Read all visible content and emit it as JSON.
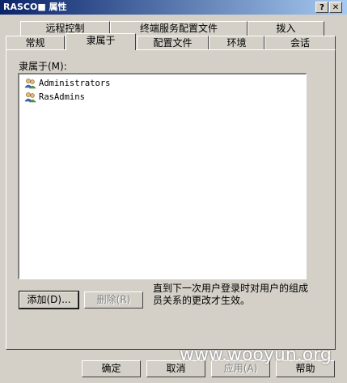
{
  "window": {
    "title": "RASCO■ 属性"
  },
  "titlebar_buttons": {
    "help": "?",
    "close": "✕"
  },
  "tabs_back": [
    "远程控制",
    "终端服务配置文件",
    "拨入"
  ],
  "tabs_front": [
    "常规",
    "隶属于",
    "配置文件",
    "环境",
    "会话"
  ],
  "active_tab": "隶属于",
  "memberof_label": "隶属于(M):",
  "members": [
    {
      "name": "Administrators",
      "icon": "group-icon"
    },
    {
      "name": "RasAdmins",
      "icon": "group-icon"
    }
  ],
  "buttons": {
    "add": "添加(D)...",
    "remove": "删除(R)",
    "ok": "确定",
    "cancel": "取消",
    "apply": "应用(A)",
    "help": "帮助"
  },
  "note": "直到下一次用户登录时对用户的组成员关系的更改才生效。",
  "watermark": "www.wooyun.org",
  "colors": {
    "face": "#d4d0c8",
    "title_start": "#0a246a",
    "title_end": "#a6caf0"
  }
}
